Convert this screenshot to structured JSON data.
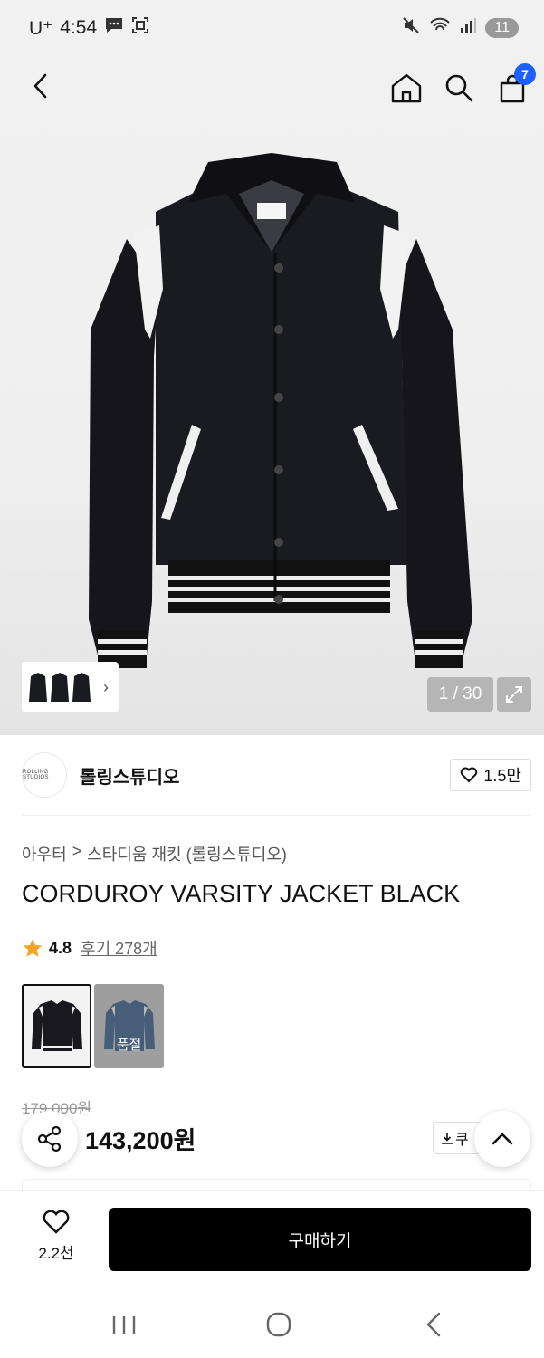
{
  "status_bar": {
    "carrier": "U⁺",
    "time": "4:54",
    "battery": "11"
  },
  "top_nav": {
    "cart_count": "7"
  },
  "gallery": {
    "counter": "1 / 30"
  },
  "brand": {
    "name": "롤링스튜디오",
    "logo_text": "ROLLING STUDIOS",
    "likes": "1.5만"
  },
  "breadcrumbs": [
    "아우터",
    "스타디움 재킷 (롤링스튜디오)"
  ],
  "breadcrumb_separator": ">",
  "product": {
    "title": "CORDUROY VARSITY JACKET BLACK",
    "rating": "4.8",
    "reviews": "후기 278개",
    "original_price": "179,000원",
    "price": "143,200원"
  },
  "options": {
    "soldout_label": "품절"
  },
  "actions": {
    "coupon_label": "쿠",
    "wish_count": "2.2천",
    "buy_label": "구매하기"
  },
  "colors": {
    "accent_badge": "#1e5fff",
    "buy_button": "#000000",
    "star": "#f5a623"
  }
}
